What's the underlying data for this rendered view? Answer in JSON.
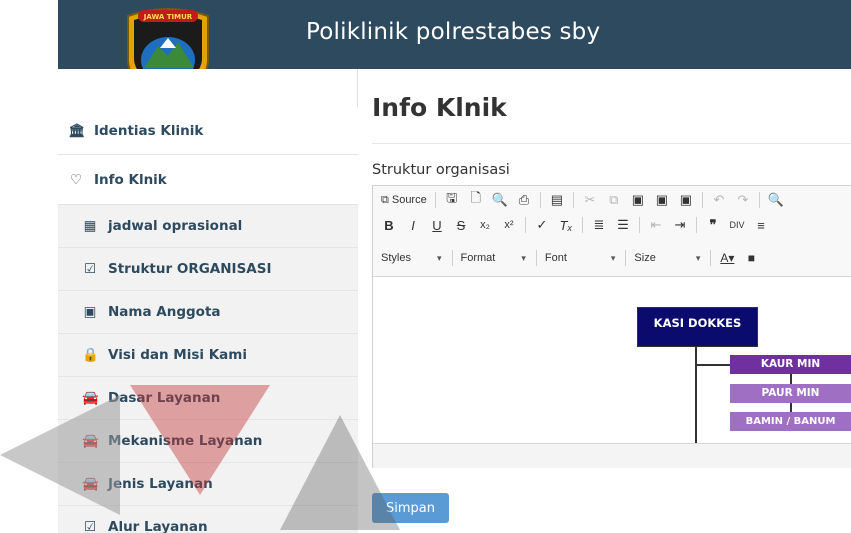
{
  "header": {
    "title": "Poliklinik polrestabes sby",
    "logo_text": "JAWA TIMUR",
    "bg_color": "#2d4a5f"
  },
  "sidebar": {
    "items": [
      {
        "label": "Identias Klinik",
        "icon": "bank-icon",
        "glyph": "🏛"
      },
      {
        "label": "Info Klnik",
        "icon": "lightbulb-icon",
        "glyph": "♡"
      },
      {
        "label": "jadwal oprasional",
        "icon": "calendar-icon",
        "glyph": "▦"
      },
      {
        "label": "Struktur ORGANISASI",
        "icon": "check-square-icon",
        "glyph": "☑"
      },
      {
        "label": "Nama Anggota",
        "icon": "id-card-icon",
        "glyph": "▣"
      },
      {
        "label": "Visi dan Misi Kami",
        "icon": "lock-icon",
        "glyph": "🔒"
      },
      {
        "label": "Dasar Layanan",
        "icon": "car-icon",
        "glyph": "🚘"
      },
      {
        "label": "Mekanisme Layanan",
        "icon": "car-icon",
        "glyph": "🚘"
      },
      {
        "label": "Jenis Layanan",
        "icon": "car-icon",
        "glyph": "🚘"
      },
      {
        "label": "Alur Layanan",
        "icon": "check-square-icon",
        "glyph": "☑"
      }
    ]
  },
  "main": {
    "title": "Info Klnik",
    "section_label": "Struktur organisasi",
    "save_label": "Simpan"
  },
  "editor": {
    "source_label": "Source",
    "styles_label": "Styles",
    "format_label": "Format",
    "font_label": "Font",
    "size_label": "Size"
  },
  "org_chart": {
    "head": "KASI DOKKES",
    "box1": "KAUR MIN",
    "box2": "PAUR MIN",
    "box3": "BAMIN / BANUM",
    "colors": {
      "head": "#0b0b6e",
      "box1": "#7030a0",
      "box2": "#9e6fc3"
    }
  },
  "colors": {
    "accent": "#5b9bd5",
    "sidebar_text": "#2d4a5f"
  }
}
